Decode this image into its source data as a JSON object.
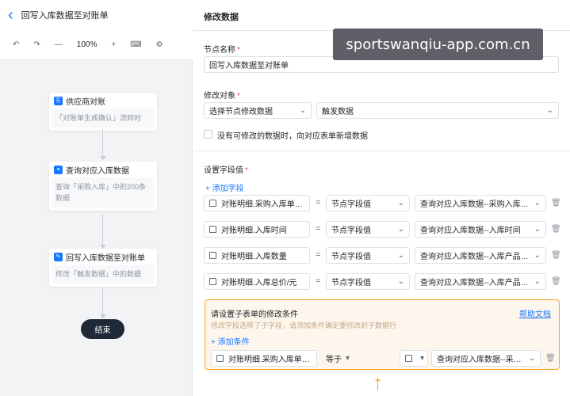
{
  "flow": {
    "title": "回写入库数据至对账单",
    "toolbar": {
      "undo": "↶",
      "redo": "↷",
      "zoom_out": "—",
      "zoom": "100%",
      "zoom_in": "+",
      "keyboard": "⌨",
      "settings": "⚙"
    }
  },
  "nodes": [
    {
      "title": "供应商对账",
      "desc": "「对账单生成确认」流转时"
    },
    {
      "title": "查询对应入库数据",
      "desc": "查询「采购入库」中的200条数据"
    },
    {
      "title": "回写入库数据至对账单",
      "desc": "修改「触发数据」中的数据"
    }
  ],
  "end_label": "结束",
  "panel": {
    "title": "修改数据",
    "node_name_label": "节点名称",
    "node_name_value": "回写入库数据至对账单",
    "target_label": "修改对象",
    "target_select": "选择节点修改数据",
    "target_value": "触发数据",
    "checkbox_label": "没有可修改的数据时，向对应表单新增数据",
    "fields_label": "设置字段值",
    "add_field": "+ 添加字段",
    "field_rows": [
      {
        "field": "对账明细.采购入库单编码",
        "type": "节点字段值",
        "value": "查询对应入库数据--采购入库单..."
      },
      {
        "field": "对账明细.入库时间",
        "type": "节点字段值",
        "value": "查询对应入库数据--入库时间"
      },
      {
        "field": "对账明细.入库数量",
        "type": "节点字段值",
        "value": "查询对应入库数据--入库产品总数"
      },
      {
        "field": "对账明细.入库总价/元",
        "type": "节点字段值",
        "value": "查询对应入库数据--入库产品采..."
      }
    ],
    "equals": "=",
    "condition": {
      "title": "请设置子表单的修改条件",
      "hint": "修改字段选择了子字段，请添加条件确定要修改的子数据行",
      "help": "帮助文档",
      "add": "+ 添加条件",
      "field": "对账明细.采购入库单编码",
      "operator": "等于",
      "value": "查询对应入库数据--采购..."
    }
  },
  "watermark": "sportswanqiu-app.com.cn",
  "colors": {
    "accent": "#1677ff",
    "highlight": "#f5a623",
    "required": "#f54a45"
  }
}
